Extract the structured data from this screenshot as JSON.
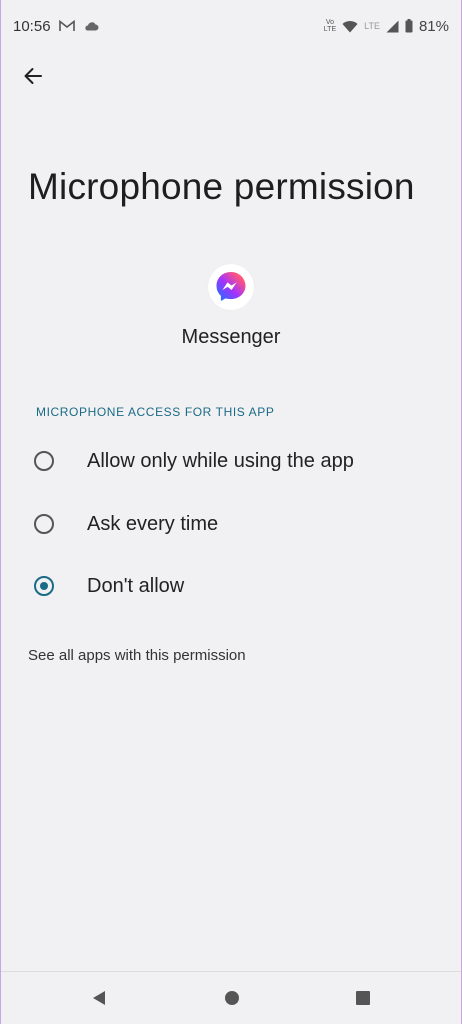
{
  "status_bar": {
    "time": "10:56",
    "battery": "81%",
    "volte_top": "Vo",
    "volte_bottom": "LTE",
    "lte": "LTE",
    "icons": [
      "gmail-icon",
      "cloud-icon",
      "wifi-icon",
      "signal-icon",
      "battery-icon"
    ]
  },
  "header": {
    "back_icon": "arrow-left-icon",
    "title": "Microphone permission"
  },
  "app": {
    "name": "Messenger",
    "icon": "messenger-icon"
  },
  "section": {
    "label": "MICROPHONE ACCESS FOR THIS APP"
  },
  "options": [
    {
      "label": "Allow only while using the app",
      "selected": false
    },
    {
      "label": "Ask every time",
      "selected": false
    },
    {
      "label": "Don't allow",
      "selected": true
    }
  ],
  "link": {
    "label": "See all apps with this permission"
  },
  "nav": {
    "icons": [
      "back-triangle-icon",
      "home-circle-icon",
      "recents-square-icon"
    ]
  },
  "colors": {
    "accent": "#1a6b86",
    "background": "#f1f1f3"
  }
}
